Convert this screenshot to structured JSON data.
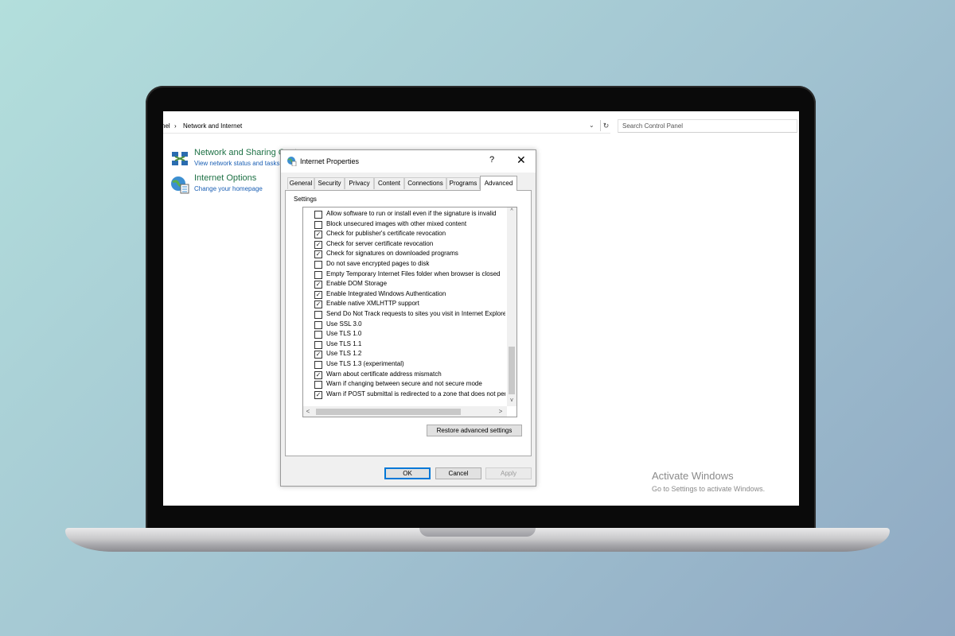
{
  "control_panel": {
    "breadcrumb_prefix": "nel",
    "breadcrumb_separator": "›",
    "breadcrumb_current": "Network and Internet",
    "dropdown_glyph": "⌄",
    "refresh_glyph": "↻",
    "search_placeholder": "Search Control Panel",
    "items": [
      {
        "title": "Network and Sharing Center",
        "subtitle": "View network status and tasks",
        "icon": "network-icon"
      },
      {
        "title": "Internet Options",
        "subtitle": "Change your homepage",
        "icon": "internet-options-icon"
      }
    ]
  },
  "dialog": {
    "title": "Internet Properties",
    "help_glyph": "?",
    "close_glyph": "✕",
    "tabs": [
      "General",
      "Security",
      "Privacy",
      "Content",
      "Connections",
      "Programs",
      "Advanced"
    ],
    "active_tab": "Advanced",
    "settings_label": "Settings",
    "options": [
      {
        "label": "Allow software to run or install even if the signature is invalid",
        "checked": false
      },
      {
        "label": "Block unsecured images with other mixed content",
        "checked": false
      },
      {
        "label": "Check for publisher's certificate revocation",
        "checked": true
      },
      {
        "label": "Check for server certificate revocation",
        "checked": true
      },
      {
        "label": "Check for signatures on downloaded programs",
        "checked": true
      },
      {
        "label": "Do not save encrypted pages to disk",
        "checked": false
      },
      {
        "label": "Empty Temporary Internet Files folder when browser is closed",
        "checked": false
      },
      {
        "label": "Enable DOM Storage",
        "checked": true
      },
      {
        "label": "Enable Integrated Windows Authentication",
        "checked": true
      },
      {
        "label": "Enable native XMLHTTP support",
        "checked": true
      },
      {
        "label": "Send Do Not Track requests to sites you visit in Internet Explorer",
        "checked": false
      },
      {
        "label": "Use SSL 3.0",
        "checked": false
      },
      {
        "label": "Use TLS 1.0",
        "checked": false
      },
      {
        "label": "Use TLS 1.1",
        "checked": false
      },
      {
        "label": "Use TLS 1.2",
        "checked": true
      },
      {
        "label": "Use TLS 1.3 (experimental)",
        "checked": false
      },
      {
        "label": "Warn about certificate address mismatch",
        "checked": true
      },
      {
        "label": "Warn if changing between secure and not secure mode",
        "checked": false
      },
      {
        "label": "Warn if POST submittal is redirected to a zone that does not permit posts",
        "checked": true
      }
    ],
    "check_glyph": "✓",
    "scroll_up_glyph": "^",
    "scroll_down_glyph": "v",
    "scroll_left_glyph": "<",
    "scroll_right_glyph": ">",
    "restore_button": "Restore advanced settings",
    "ok_button": "OK",
    "cancel_button": "Cancel",
    "apply_button": "Apply"
  },
  "watermark": {
    "title": "Activate Windows",
    "subtitle": "Go to Settings to activate Windows."
  }
}
